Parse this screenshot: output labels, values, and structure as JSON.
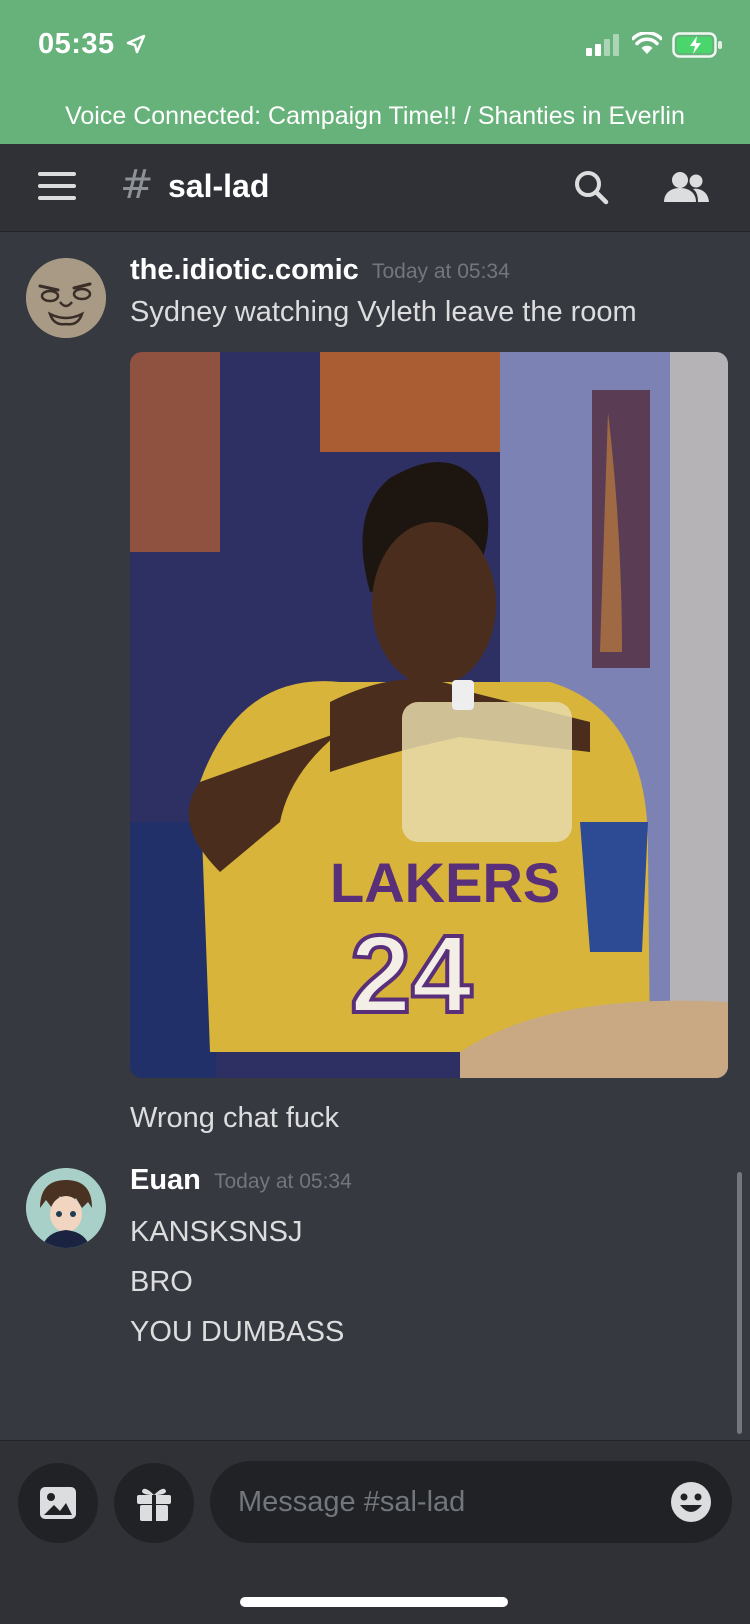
{
  "status": {
    "time": "05:35"
  },
  "voice_banner": "Voice Connected: Campaign Time!! / Shanties in Everlin",
  "header": {
    "hash": "#",
    "channel": "sal-lad"
  },
  "messages": [
    {
      "author": "the.idiotic.comic",
      "timestamp": "Today at 05:34",
      "lines": [
        "Sydney watching Vyleth leave the room"
      ],
      "after_image": "Wrong chat fuck"
    },
    {
      "author": "Euan",
      "timestamp": "Today at 05:34",
      "lines": [
        "KANSKSNSJ",
        "BRO",
        "YOU DUMBASS"
      ]
    }
  ],
  "input": {
    "placeholder": "Message #sal-lad"
  },
  "colors": {
    "status_green": "#67b27a",
    "background": "#36393f",
    "header": "#2f3136",
    "field": "#202225"
  },
  "icons": [
    "location-arrow-icon",
    "signal-icon",
    "wifi-icon",
    "battery-charging-icon",
    "menu-icon",
    "hash-icon",
    "search-icon",
    "members-icon",
    "image-upload-icon",
    "gift-icon",
    "emoji-icon"
  ]
}
